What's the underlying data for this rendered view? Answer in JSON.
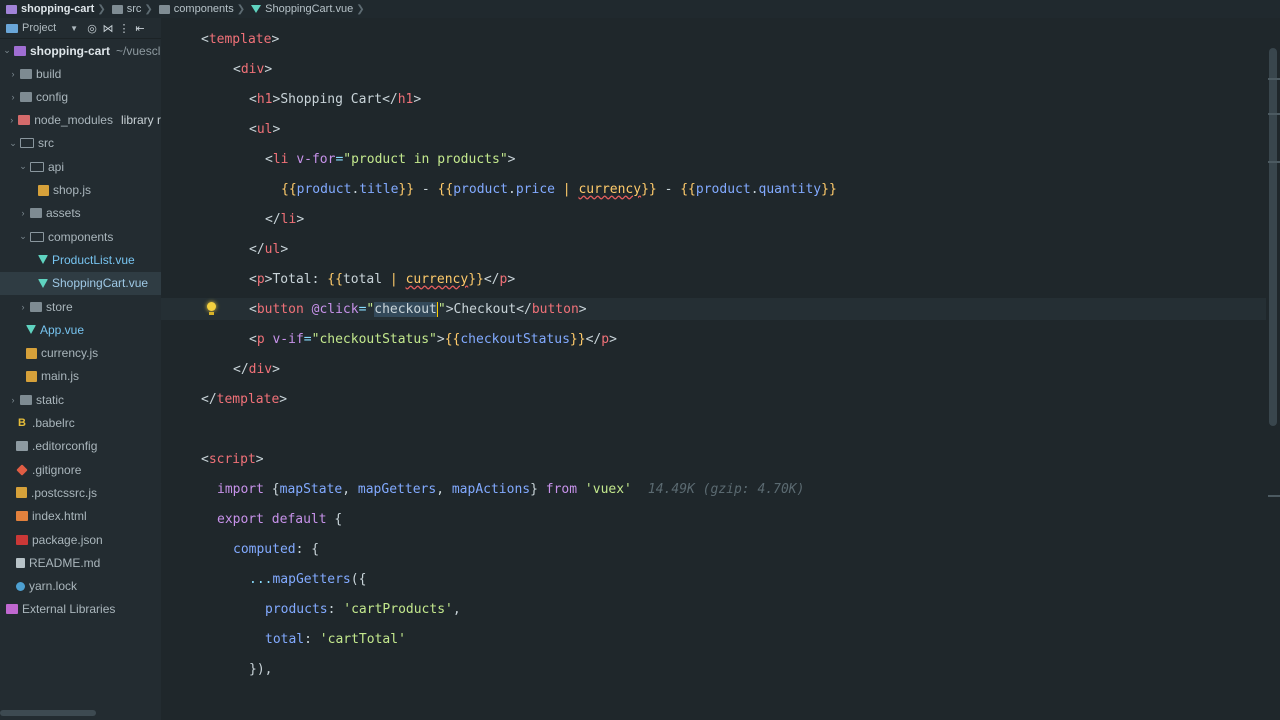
{
  "breadcrumb": {
    "items": [
      {
        "label": "shopping-cart",
        "icon": "project-folder-icon"
      },
      {
        "label": "src",
        "icon": "folder-icon"
      },
      {
        "label": "components",
        "icon": "folder-icon"
      },
      {
        "label": "ShoppingCart.vue",
        "icon": "vue-file-icon"
      }
    ]
  },
  "sidebar": {
    "view_picker": "Project",
    "toolbar_icons": [
      "target-icon",
      "collapse-icon",
      "settings-icon",
      "hide-icon"
    ],
    "root": {
      "label": "shopping-cart",
      "path": "~/vuescl"
    },
    "items": [
      {
        "label": "build",
        "icon": "folder-icon",
        "chevron": "›"
      },
      {
        "label": "config",
        "icon": "folder-icon",
        "chevron": "›"
      },
      {
        "label": "node_modules",
        "extra": "library r",
        "icon": "folder-red-icon",
        "chevron": "›"
      },
      {
        "label": "src",
        "icon": "folder-open-icon",
        "chevron": "⌄"
      },
      {
        "label": "api",
        "icon": "folder-open-icon",
        "chevron": "⌄"
      },
      {
        "label": "shop.js",
        "icon": "js-file-icon"
      },
      {
        "label": "assets",
        "icon": "folder-icon",
        "chevron": "›"
      },
      {
        "label": "components",
        "icon": "folder-open-icon",
        "chevron": "⌄"
      },
      {
        "label": "ProductList.vue",
        "icon": "vue-file-icon"
      },
      {
        "label": "ShoppingCart.vue",
        "icon": "vue-file-icon",
        "selected": true
      },
      {
        "label": "store",
        "icon": "folder-icon",
        "chevron": "›"
      },
      {
        "label": "App.vue",
        "icon": "vue-file-icon"
      },
      {
        "label": "currency.js",
        "icon": "js-file-icon"
      },
      {
        "label": "main.js",
        "icon": "js-file-icon"
      },
      {
        "label": "static",
        "icon": "folder-icon",
        "chevron": "›"
      },
      {
        "label": ".babelrc",
        "icon": "babel-icon"
      },
      {
        "label": ".editorconfig",
        "icon": "config-icon"
      },
      {
        "label": ".gitignore",
        "icon": "git-icon"
      },
      {
        "label": ".postcssrc.js",
        "icon": "js-file-icon"
      },
      {
        "label": "index.html",
        "icon": "html-file-icon"
      },
      {
        "label": "package.json",
        "icon": "npm-icon"
      },
      {
        "label": "README.md",
        "icon": "markdown-icon"
      },
      {
        "label": "yarn.lock",
        "icon": "yarn-icon"
      },
      {
        "label": "External Libraries",
        "icon": "library-icon"
      }
    ]
  },
  "editor": {
    "hint": "14.49K (gzip: 4.70K)",
    "lines": [
      [
        "<",
        "template",
        ">"
      ],
      [
        "<",
        "div",
        ">"
      ],
      [
        "<",
        "h1",
        ">",
        "Shopping Cart",
        "</",
        "h1",
        ">"
      ],
      [
        "<",
        "ul",
        ">"
      ],
      [
        "<",
        "li",
        " ",
        "v-for",
        "=",
        "\"product in products\"",
        ">"
      ],
      [
        "{{",
        "product",
        ".",
        "title",
        "}}",
        " - ",
        "{{",
        "product",
        ".",
        "price",
        " | ",
        "currency",
        "}}",
        " - ",
        "{{",
        "product",
        ".",
        "quantity",
        "}}"
      ],
      [
        "</",
        "li",
        ">"
      ],
      [
        "</",
        "ul",
        ">"
      ],
      [
        "<",
        "p",
        ">",
        "Total: ",
        "{{",
        "total",
        " | ",
        "currency",
        "}}",
        "</",
        "p",
        ">"
      ],
      [
        "<",
        "button",
        " ",
        "@click",
        "=",
        "\"",
        "checkout",
        "\"",
        ">",
        "Checkout",
        "</",
        "button",
        ">"
      ],
      [
        "<",
        "p",
        " ",
        "v-if",
        "=",
        "\"checkoutStatus\"",
        ">",
        "{{",
        "checkoutStatus",
        "}}",
        "</",
        "p",
        ">"
      ],
      [
        "</",
        "div",
        ">"
      ],
      [
        "</",
        "template",
        ">"
      ],
      [],
      [
        "<",
        "script",
        ">"
      ],
      [
        "import",
        " {",
        "mapState",
        ", ",
        "mapGetters",
        ", ",
        "mapActions",
        "} ",
        "from",
        " ",
        "'vuex'"
      ],
      [
        "export",
        " ",
        "default",
        " {"
      ],
      [
        "computed",
        ": {"
      ],
      [
        "...",
        "mapGetters",
        "({"
      ],
      [
        "products",
        ": ",
        "'cartProducts'",
        ","
      ],
      [
        "total",
        ": ",
        "'cartTotal'"
      ],
      [
        "}),"
      ]
    ]
  }
}
